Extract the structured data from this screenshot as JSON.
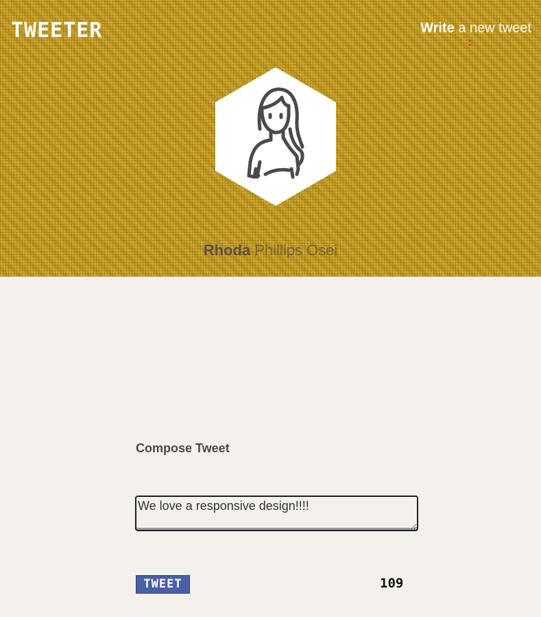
{
  "nav": {
    "logo": "TWEETER",
    "write_bold": "Write",
    "write_rest": " a new tweet",
    "chevron_icon": "double-chevron-down-icon",
    "chevron_color": "#e0301e"
  },
  "profile": {
    "avatar_icon": "woman-avatar-icon",
    "first_name": "Rhoda",
    "last_name": " Phillips Osei"
  },
  "compose": {
    "title": "Compose Tweet",
    "text": "We love a responsive design!!!!",
    "button_label": "TWEET",
    "counter": "109"
  },
  "colors": {
    "header_bg": "#c9a228",
    "page_bg": "#f4f1ec",
    "button_bg": "#4a5fa6"
  }
}
